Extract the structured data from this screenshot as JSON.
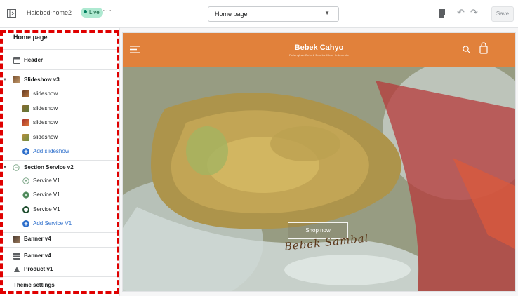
{
  "topbar": {
    "exit_icon": "exit-icon",
    "theme_name": "Halobod-home2",
    "live_badge": "Live",
    "more_icon": "more-horizontal-icon",
    "page_select": {
      "value": "Home page",
      "icon": "chevron-down-icon"
    },
    "device_icon": "mobile-device-icon",
    "undo_icon": "undo-icon",
    "redo_icon": "redo-icon",
    "save_label": "Save"
  },
  "sidebar": {
    "title": "Home page",
    "items": [
      {
        "label": "Header",
        "icon": "header-icon",
        "bold": true
      },
      {
        "label": "Slideshow v3",
        "icon": "slideshow-thumb",
        "bold": true,
        "expanded": true
      },
      {
        "label": "slideshow",
        "icon": "image-thumb-1"
      },
      {
        "label": "slideshow",
        "icon": "image-thumb-2"
      },
      {
        "label": "slideshow",
        "icon": "image-thumb-3"
      },
      {
        "label": "slideshow",
        "icon": "image-thumb-4"
      },
      {
        "label": "Add slideshow",
        "icon": "plus-circle-icon",
        "link": true
      },
      {
        "label": "Section Service v2",
        "icon": "section-service-icon",
        "bold": true,
        "expanded": true
      },
      {
        "label": "Service V1",
        "icon": "service-icon-1"
      },
      {
        "label": "Service V1",
        "icon": "service-icon-2"
      },
      {
        "label": "Service V1",
        "icon": "service-icon-3"
      },
      {
        "label": "Add Service V1",
        "icon": "plus-circle-icon",
        "link": true
      },
      {
        "label": "Banner v4",
        "icon": "banner-thumb",
        "bold": true
      },
      {
        "label": "Banner v4",
        "icon": "banner-thumb-2",
        "bold": true
      },
      {
        "label": "Product v1",
        "icon": "product-thumb",
        "bold": true
      }
    ],
    "theme_settings": "Theme settings"
  },
  "preview": {
    "brand": "Bebek Cahyo",
    "brand_tagline": "Pelengkap Bebek Bumbu Khas Indonesia",
    "menu_icon": "hamburger-menu-icon",
    "search_icon": "search-icon",
    "cart_icon": "shopping-bag-icon",
    "shop_button": "Shop now",
    "hero_script": "Bebek Sambal"
  },
  "colors": {
    "accent_header": "#e1813b",
    "live_badge": "#aee9d1",
    "link": "#2c6ecb",
    "selection_dashed": "#e00000"
  }
}
